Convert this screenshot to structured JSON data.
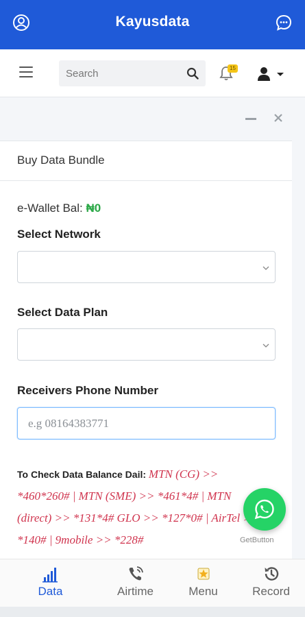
{
  "appbar": {
    "title": "Kayusdata"
  },
  "navbar": {
    "search_placeholder": "Search",
    "notification_count": "15"
  },
  "card": {
    "title": "Buy Data Bundle",
    "wallet_label": "e-Wallet Bal: ",
    "wallet_amount": "₦0",
    "network_label": "Select Network",
    "network_value": "",
    "plan_label": "Select Data Plan",
    "plan_value": "",
    "phone_label": "Receivers Phone Number",
    "phone_placeholder": "e.g 08164383771",
    "phone_value": "",
    "balance_intro": "To Check Data Balance Dail: ",
    "balance_codes": "MTN (CG) >> *460*260# | MTN (SME) >> *461*4# | MTN (direct) >> *131*4# GLO >> *127*0# | AirTel >> *140# | 9mobile >> *228#"
  },
  "floating": {
    "getbutton_label": "GetButton"
  },
  "bottom_nav": {
    "items": [
      {
        "label": "Data",
        "icon": "signal-bars-icon",
        "active": true
      },
      {
        "label": "Airtime",
        "icon": "phone-ringing-icon",
        "active": false
      },
      {
        "label": "Menu",
        "icon": "star-menu-icon",
        "active": false
      },
      {
        "label": "Record",
        "icon": "history-icon",
        "active": false
      }
    ]
  },
  "colors": {
    "primary": "#1f5ad8",
    "wallet_green": "#28a745",
    "codes_red": "#d0344e",
    "whatsapp": "#25d366",
    "badge": "#f5c518"
  }
}
